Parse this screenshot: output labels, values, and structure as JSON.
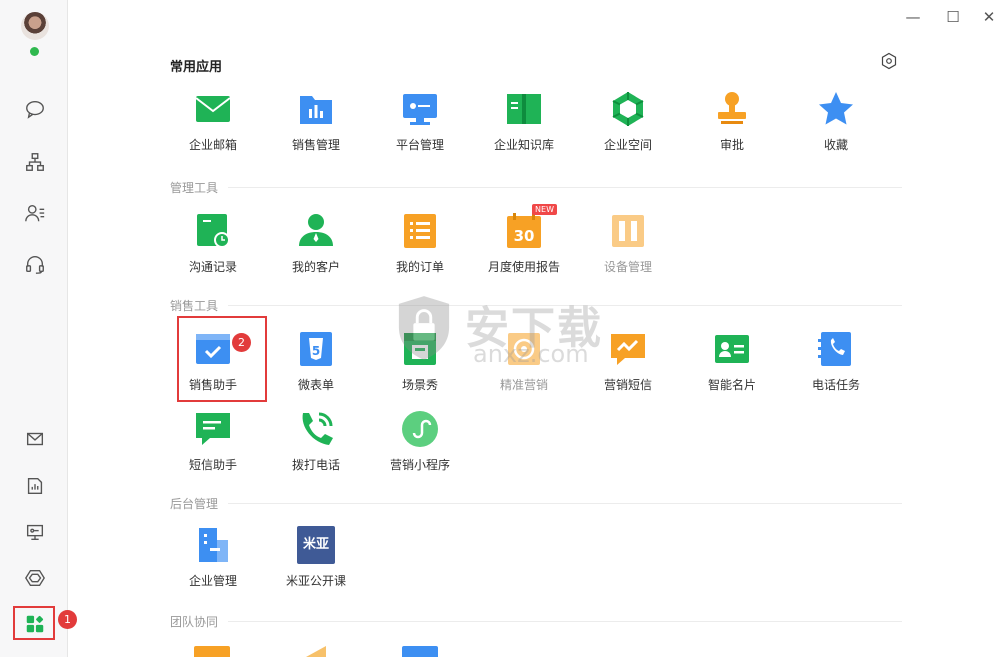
{
  "window": {
    "controls": [
      "—",
      "☐",
      "✕"
    ]
  },
  "sidebar": {
    "icons": [
      "chat-icon",
      "org-chart-icon",
      "contacts-icon",
      "headset-icon",
      "mail-icon",
      "report-icon",
      "monitor-icon",
      "hexagon-icon",
      "apps-icon"
    ],
    "apps_badge": "1"
  },
  "sections": {
    "common": {
      "title": "常用应用",
      "items": [
        "企业邮箱",
        "销售管理",
        "平台管理",
        "企业知识库",
        "企业空间",
        "审批",
        "收藏"
      ]
    },
    "management": {
      "title": "管理工具",
      "items": [
        "沟通记录",
        "我的客户",
        "我的订单",
        "月度使用报告",
        "设备管理"
      ],
      "new_tag": "NEW"
    },
    "sales": {
      "title": "销售工具",
      "items": [
        "销售助手",
        "微表单",
        "场景秀",
        "精准营销",
        "营销短信",
        "智能名片",
        "电话任务",
        "短信助手",
        "拨打电话",
        "营销小程序"
      ],
      "badge": "2"
    },
    "backend": {
      "title": "后台管理",
      "items": [
        "企业管理",
        "米亚公开课"
      ],
      "miya_icon_text": "米亚"
    },
    "team": {
      "title": "团队协同"
    }
  },
  "watermark": {
    "text": "安下载",
    "sub": "anxz.com"
  },
  "colors": {
    "green": "#1fb356",
    "blue": "#3d8ff2",
    "orange": "#f7a125",
    "red": "#e23b3b"
  }
}
